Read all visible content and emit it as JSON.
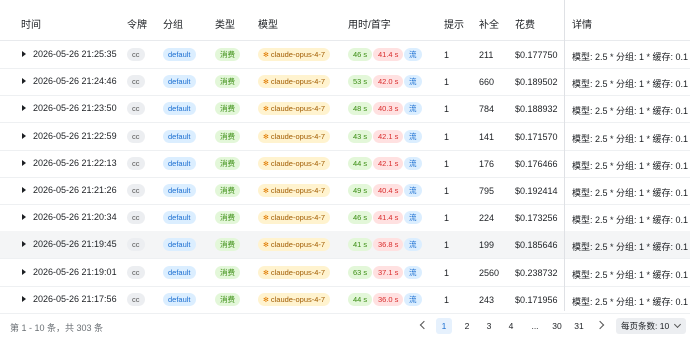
{
  "table": {
    "headers": {
      "time": "时间",
      "token": "令牌",
      "group": "分组",
      "type": "类型",
      "model": "模型",
      "timing": "用时/首字",
      "hint": "提示",
      "completion": "补全",
      "cost": "花费",
      "detail": "详情"
    },
    "rows": [
      {
        "time": "2026-05-26 21:25:35",
        "token": "cc",
        "group": "default",
        "type": "消费",
        "model": "claude-opus-4-7",
        "duration": "46 s",
        "first": "41.4 s",
        "stream": "流",
        "hint": "1",
        "completion": "211",
        "cost": "$0.177750",
        "detail": "模型: 2.5 * 分组: 1 * 缓存: 0.1"
      },
      {
        "time": "2026-05-26 21:24:46",
        "token": "cc",
        "group": "default",
        "type": "消费",
        "model": "claude-opus-4-7",
        "duration": "53 s",
        "first": "42.0 s",
        "stream": "流",
        "hint": "1",
        "completion": "660",
        "cost": "$0.189502",
        "detail": "模型: 2.5 * 分组: 1 * 缓存: 0.1"
      },
      {
        "time": "2026-05-26 21:23:50",
        "token": "cc",
        "group": "default",
        "type": "消费",
        "model": "claude-opus-4-7",
        "duration": "48 s",
        "first": "40.3 s",
        "stream": "流",
        "hint": "1",
        "completion": "784",
        "cost": "$0.188932",
        "detail": "模型: 2.5 * 分组: 1 * 缓存: 0.1"
      },
      {
        "time": "2026-05-26 21:22:59",
        "token": "cc",
        "group": "default",
        "type": "消费",
        "model": "claude-opus-4-7",
        "duration": "43 s",
        "first": "42.1 s",
        "stream": "流",
        "hint": "1",
        "completion": "141",
        "cost": "$0.171570",
        "detail": "模型: 2.5 * 分组: 1 * 缓存: 0.1"
      },
      {
        "time": "2026-05-26 21:22:13",
        "token": "cc",
        "group": "default",
        "type": "消费",
        "model": "claude-opus-4-7",
        "duration": "44 s",
        "first": "42.1 s",
        "stream": "流",
        "hint": "1",
        "completion": "176",
        "cost": "$0.176466",
        "detail": "模型: 2.5 * 分组: 1 * 缓存: 0.1"
      },
      {
        "time": "2026-05-26 21:21:26",
        "token": "cc",
        "group": "default",
        "type": "消费",
        "model": "claude-opus-4-7",
        "duration": "49 s",
        "first": "40.4 s",
        "stream": "流",
        "hint": "1",
        "completion": "795",
        "cost": "$0.192414",
        "detail": "模型: 2.5 * 分组: 1 * 缓存: 0.1"
      },
      {
        "time": "2026-05-26 21:20:34",
        "token": "cc",
        "group": "default",
        "type": "消费",
        "model": "claude-opus-4-7",
        "duration": "46 s",
        "first": "41.4 s",
        "stream": "流",
        "hint": "1",
        "completion": "224",
        "cost": "$0.173256",
        "detail": "模型: 2.5 * 分组: 1 * 缓存: 0.1"
      },
      {
        "time": "2026-05-26 21:19:45",
        "token": "cc",
        "group": "default",
        "type": "消费",
        "model": "claude-opus-4-7",
        "duration": "41 s",
        "first": "36.8 s",
        "stream": "流",
        "hint": "1",
        "completion": "199",
        "cost": "$0.185646",
        "detail": "模型: 2.5 * 分组: 1 * 缓存: 0.1"
      },
      {
        "time": "2026-05-26 21:19:01",
        "token": "cc",
        "group": "default",
        "type": "消费",
        "model": "claude-opus-4-7",
        "duration": "63 s",
        "first": "37.1 s",
        "stream": "流",
        "hint": "1",
        "completion": "2560",
        "cost": "$0.238732",
        "detail": "模型: 2.5 * 分组: 1 * 缓存: 0.1"
      },
      {
        "time": "2026-05-26 21:17:56",
        "token": "cc",
        "group": "default",
        "type": "消费",
        "model": "claude-opus-4-7",
        "duration": "44 s",
        "first": "36.0 s",
        "stream": "流",
        "hint": "1",
        "completion": "243",
        "cost": "$0.171956",
        "detail": "模型: 2.5 * 分组: 1 * 缓存: 0.1"
      }
    ]
  },
  "footer": {
    "summary": "第 1 - 10 条，共 303 条",
    "pages": [
      "1",
      "2",
      "3",
      "4",
      "...",
      "30",
      "31"
    ],
    "active_page": "1",
    "page_size_label": "每页条数: 10"
  },
  "colors": {
    "accent": "#1c6fd1",
    "success": "#3a8d12",
    "danger": "#d92d2d",
    "warning": "#a15c00"
  }
}
